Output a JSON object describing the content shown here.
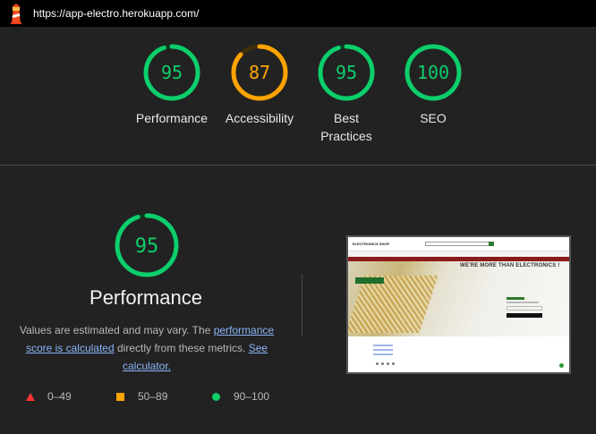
{
  "header": {
    "url": "https://app-electro.herokuapp.com/"
  },
  "colors": {
    "pass": "#0cce6b",
    "average": "#ffa400",
    "fail": "#ff3333",
    "pass_text": "#0cce6b",
    "average_text": "#ffa400",
    "pass_track": "#0b3a23",
    "average_track": "#3d2e0c"
  },
  "scores": [
    {
      "value": "95",
      "label_line1": "Performance",
      "label_line2": "",
      "level": 0.95,
      "rating": "pass"
    },
    {
      "value": "87",
      "label_line1": "Accessibility",
      "label_line2": "",
      "level": 0.87,
      "rating": "average"
    },
    {
      "value": "95",
      "label_line1": "Best",
      "label_line2": "Practices",
      "level": 0.95,
      "rating": "pass"
    },
    {
      "value": "100",
      "label_line1": "SEO",
      "label_line2": "",
      "level": 1.0,
      "rating": "pass"
    }
  ],
  "performance": {
    "score": "95",
    "level": 0.95,
    "title": "Performance",
    "desc_text_1": "Values are estimated and may vary. The ",
    "desc_link_1": "performance score is calculated",
    "desc_text_2": " directly from these metrics. ",
    "desc_link_2": "See calculator.",
    "desc_text_3": ""
  },
  "legend": [
    {
      "icon": "triangle-icon",
      "range": "0–49"
    },
    {
      "icon": "square-icon",
      "range": "50–89"
    },
    {
      "icon": "circle-icon",
      "range": "90–100"
    }
  ],
  "screenshot": {
    "brand": "ELECTRONICS SHOP",
    "tagline": "WE'RE MORE THAN ELECTRONICS !"
  }
}
